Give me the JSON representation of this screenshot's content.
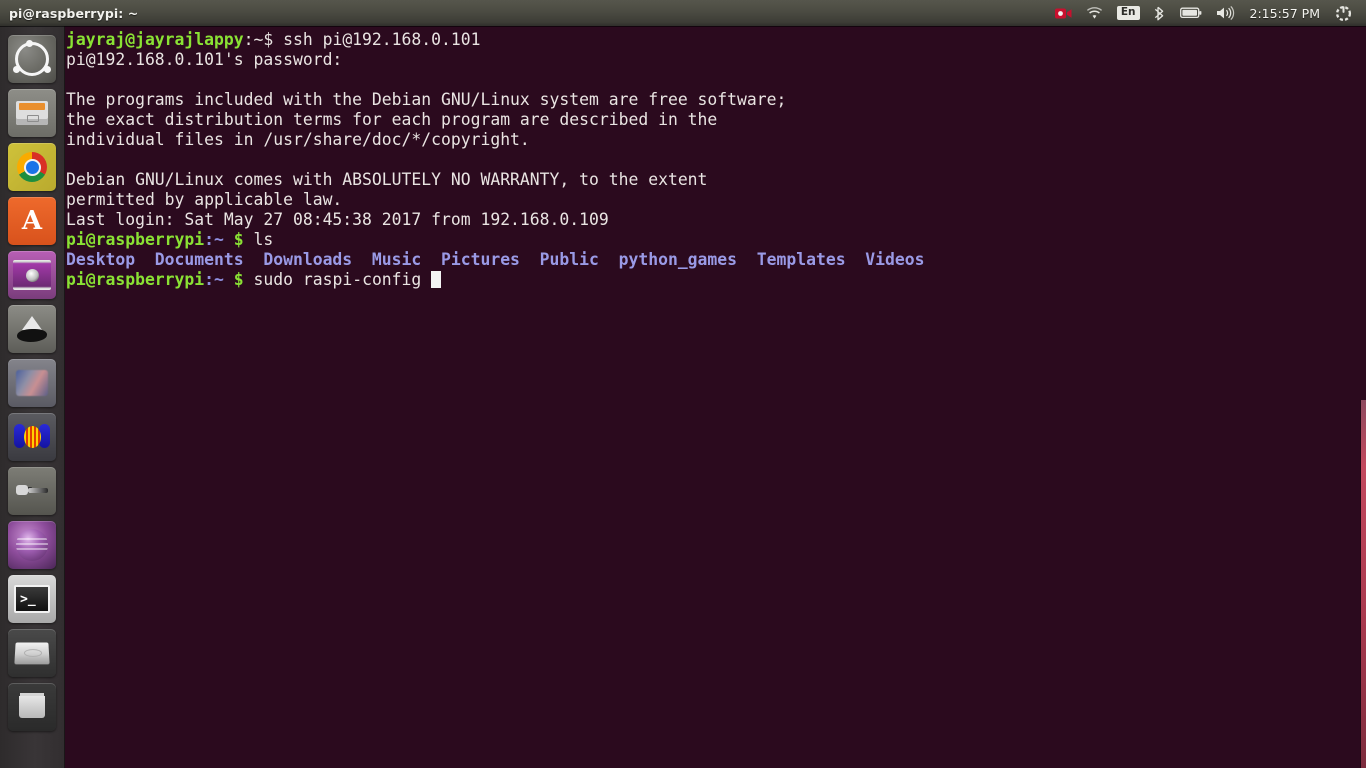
{
  "window": {
    "title": "pi@raspberrypi: ~"
  },
  "panel": {
    "tray": [
      {
        "name": "screen-recorder-icon",
        "glyph": "record"
      },
      {
        "name": "wifi-icon",
        "glyph": "wifi"
      },
      {
        "name": "keyboard-layout-icon",
        "label": "En"
      },
      {
        "name": "bluetooth-icon",
        "glyph": "bluetooth"
      },
      {
        "name": "battery-icon",
        "glyph": "battery"
      },
      {
        "name": "volume-icon",
        "glyph": "volume"
      }
    ],
    "clock": "2:15:57 PM",
    "session_menu": "power-gear"
  },
  "launcher": {
    "items": [
      {
        "label": "Ubuntu Dash Home",
        "icon": "ubuntu-dash-icon",
        "active": false
      },
      {
        "label": "Files",
        "icon": "files-icon",
        "active": false
      },
      {
        "label": "Google Chrome",
        "icon": "chrome-icon",
        "active": false
      },
      {
        "label": "Ubuntu Software Center",
        "icon": "software-center-icon",
        "active": false
      },
      {
        "label": "Media Player",
        "icon": "media-player-icon",
        "active": false
      },
      {
        "label": "Inkscape",
        "icon": "inkscape-icon",
        "active": false
      },
      {
        "label": "GIMP Image Editor",
        "icon": "gimp-icon",
        "active": false
      },
      {
        "label": "Audacity",
        "icon": "audacity-icon",
        "active": false
      },
      {
        "label": "System Tool",
        "icon": "system-tool-icon",
        "active": false
      },
      {
        "label": "Amarok",
        "icon": "amarok-globe-icon",
        "active": false
      },
      {
        "label": "Terminal",
        "icon": "terminal-icon",
        "active": true
      },
      {
        "label": "Devices",
        "icon": "disk-drive-icon",
        "active": false
      },
      {
        "label": "Trash",
        "icon": "trash-icon",
        "active": false
      }
    ]
  },
  "terminal": {
    "background_color": "#2b0a1e",
    "foreground_color": "#e9e4e2",
    "prompt_color": "#8ae234",
    "directory_color": "#9a9ae6",
    "lines": [
      {
        "id": "line-ssh-command",
        "segments": [
          {
            "text": "jayraj@jayrajlappy",
            "class": "c-green"
          },
          {
            "text": ":~$ ",
            "class": "c-white"
          },
          {
            "text": "ssh pi@192.168.0.101",
            "class": "c-white"
          }
        ]
      },
      {
        "id": "line-password-prompt",
        "segments": [
          {
            "text": "pi@192.168.0.101's password: ",
            "class": "c-white"
          }
        ]
      },
      {
        "id": "line-blank-1",
        "segments": [
          {
            "text": " ",
            "class": "c-white"
          }
        ]
      },
      {
        "id": "line-motd-1",
        "segments": [
          {
            "text": "The programs included with the Debian GNU/Linux system are free software;",
            "class": "c-white"
          }
        ]
      },
      {
        "id": "line-motd-2",
        "segments": [
          {
            "text": "the exact distribution terms for each program are described in the",
            "class": "c-white"
          }
        ]
      },
      {
        "id": "line-motd-3",
        "segments": [
          {
            "text": "individual files in /usr/share/doc/*/copyright.",
            "class": "c-white"
          }
        ]
      },
      {
        "id": "line-blank-2",
        "segments": [
          {
            "text": " ",
            "class": "c-white"
          }
        ]
      },
      {
        "id": "line-warranty-1",
        "segments": [
          {
            "text": "Debian GNU/Linux comes with ABSOLUTELY NO WARRANTY, to the extent",
            "class": "c-white"
          }
        ]
      },
      {
        "id": "line-warranty-2",
        "segments": [
          {
            "text": "permitted by applicable law.",
            "class": "c-white"
          }
        ]
      },
      {
        "id": "line-last-login",
        "segments": [
          {
            "text": "Last login: Sat May 27 08:45:38 2017 from 192.168.0.109",
            "class": "c-white"
          }
        ]
      },
      {
        "id": "line-ls-command",
        "segments": [
          {
            "text": "pi@raspberrypi",
            "class": "c-green"
          },
          {
            "text": ":~",
            "class": "c-blue"
          },
          {
            "text": " ",
            "class": "c-white"
          },
          {
            "text": "$",
            "class": "c-green"
          },
          {
            "text": " ls",
            "class": "c-white"
          }
        ]
      },
      {
        "id": "line-ls-output",
        "segments": [
          {
            "text": "Desktop  Documents  Downloads  Music  Pictures  Public  python_games  Templates  Videos",
            "class": "c-dirblue"
          }
        ]
      },
      {
        "id": "line-raspi-config",
        "segments": [
          {
            "text": "pi@raspberrypi",
            "class": "c-green"
          },
          {
            "text": ":~",
            "class": "c-blue"
          },
          {
            "text": " ",
            "class": "c-white"
          },
          {
            "text": "$",
            "class": "c-green"
          },
          {
            "text": " sudo raspi-config ",
            "class": "c-white"
          }
        ],
        "cursor": true
      }
    ]
  }
}
